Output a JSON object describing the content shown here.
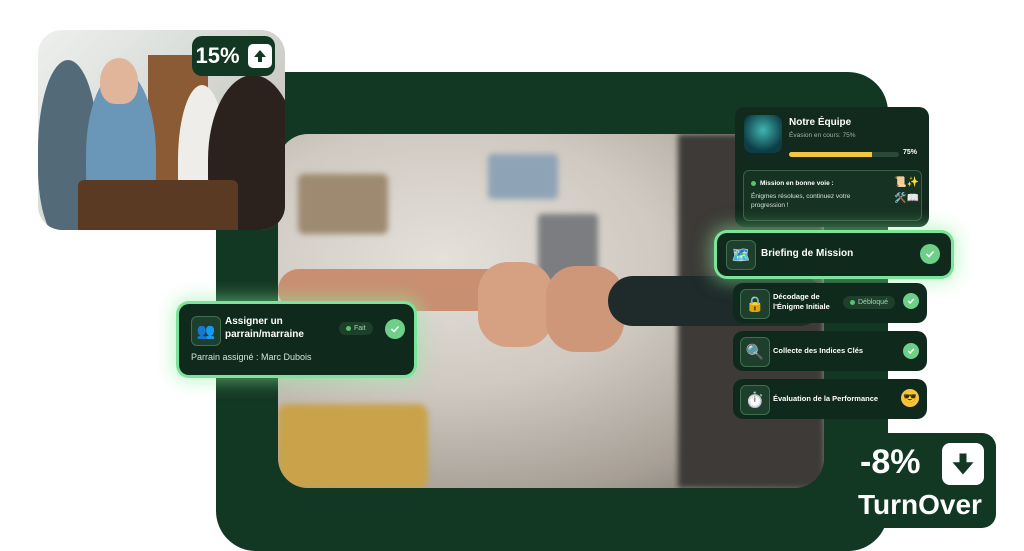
{
  "growth_badge": {
    "value": "15%"
  },
  "team_card": {
    "title": "Notre Équipe",
    "subtitle": "Évasion en cours: 75%",
    "progress": 0.75,
    "progress_label": "75%",
    "status_title": "Mission en bonne voie :",
    "status_text": "Énigmes résolues, continuez votre progression !"
  },
  "missions": [
    {
      "label": "Briefing de Mission",
      "icon": "map-icon",
      "state": "check"
    },
    {
      "label": "Décodage de l'Énigme Initiale",
      "icon": "lock-icon",
      "state": "check",
      "badge": "Débloqué"
    },
    {
      "label": "Collecte des Indices Clés",
      "icon": "magnifier-icon",
      "state": "check"
    },
    {
      "label": "Évaluation de la Performance",
      "icon": "stopwatch-icon",
      "state": "emoji"
    }
  ],
  "mentor_card": {
    "title": "Assigner un parrain/marraine",
    "badge": "Fait",
    "detail": "Parrain assigné : Marc Dubois"
  },
  "turnover_badge": {
    "value": "-8%",
    "label": "TurnOver"
  },
  "colors": {
    "frame": "#123723",
    "card": "#0f2a1c",
    "accent": "#6ed088",
    "progress": "#f4c542"
  }
}
